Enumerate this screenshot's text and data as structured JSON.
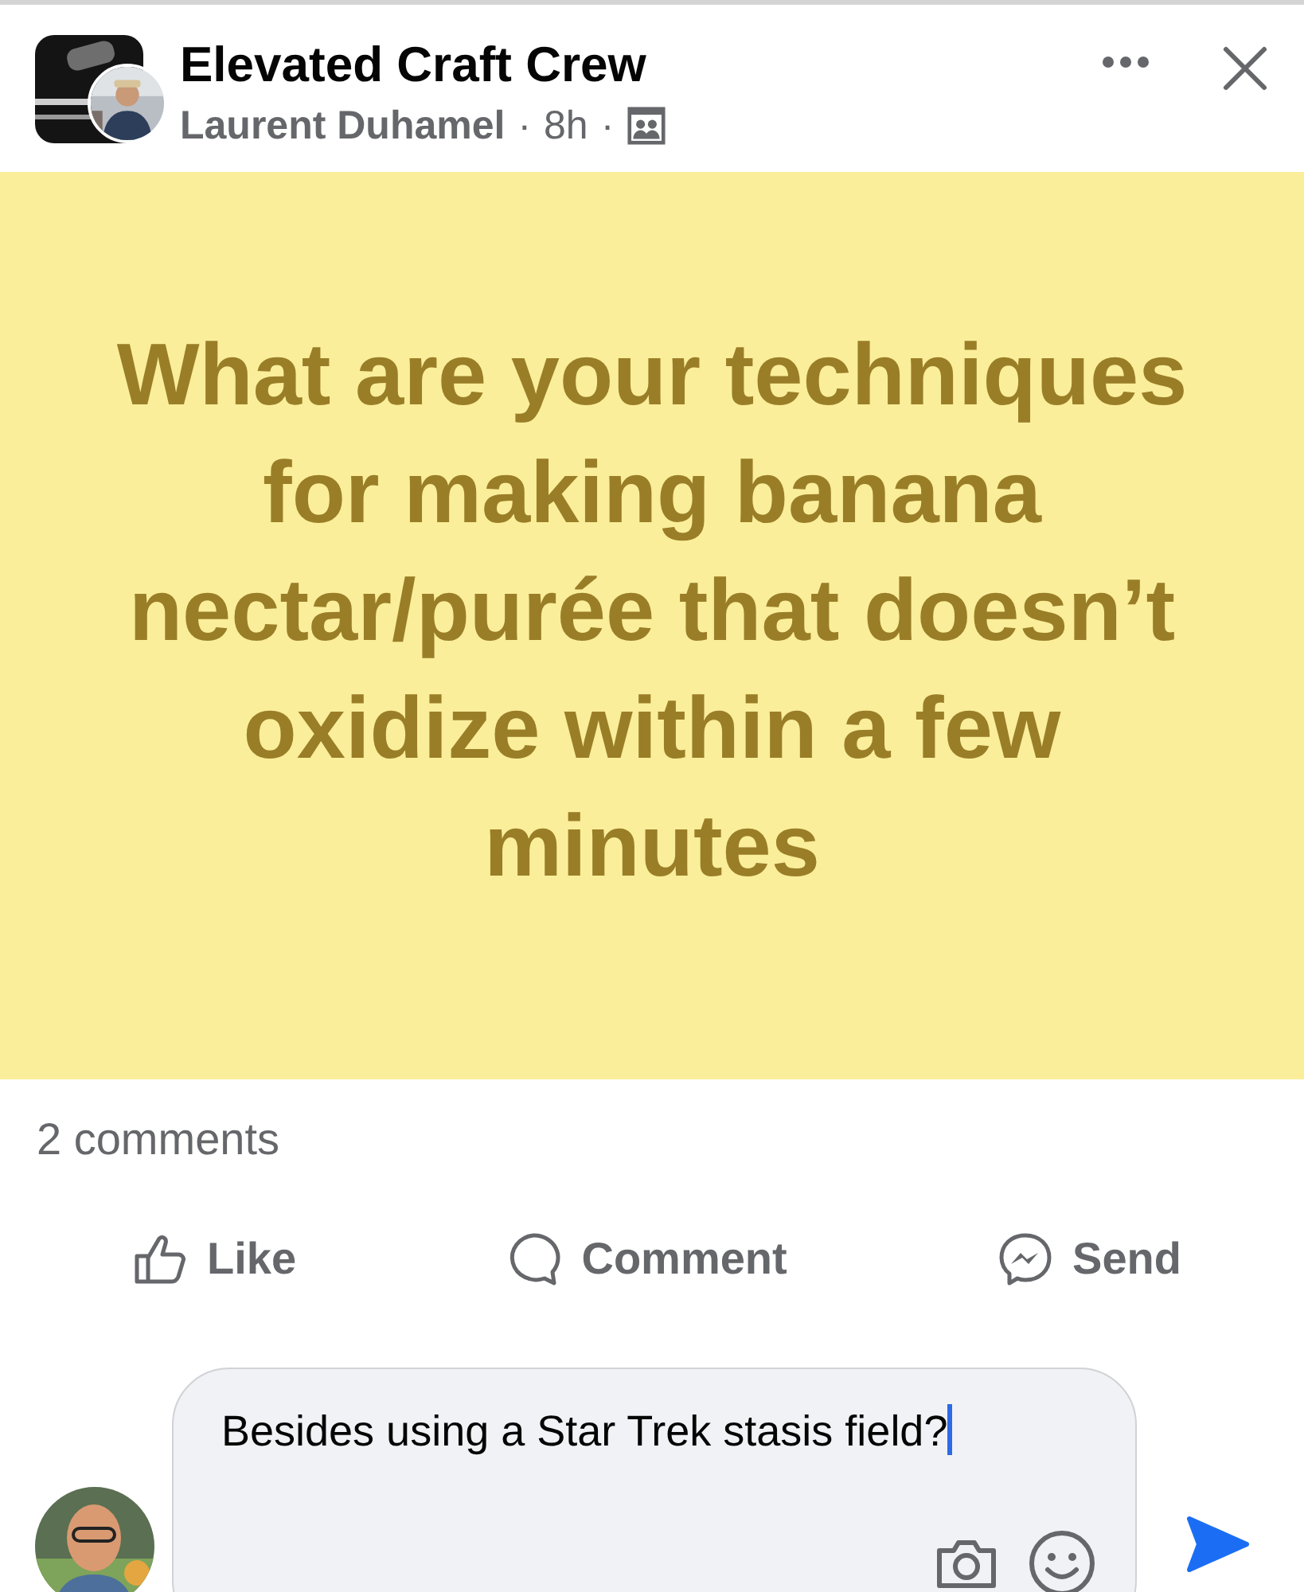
{
  "post": {
    "group": "Elevated Craft Crew",
    "author": "Laurent Duhamel",
    "time": "8h",
    "separator": "·"
  },
  "card": {
    "text": "What are your techniques for making banana nectar/purée that doesn’t oxidize within a few minutes"
  },
  "comments_count": "2 comments",
  "actions": [
    {
      "kind": "like",
      "label": "Like"
    },
    {
      "kind": "comment",
      "label": "Comment"
    },
    {
      "kind": "send",
      "label": "Send"
    }
  ],
  "composer": {
    "value": "Besides using a Star Trek stasis field?"
  }
}
